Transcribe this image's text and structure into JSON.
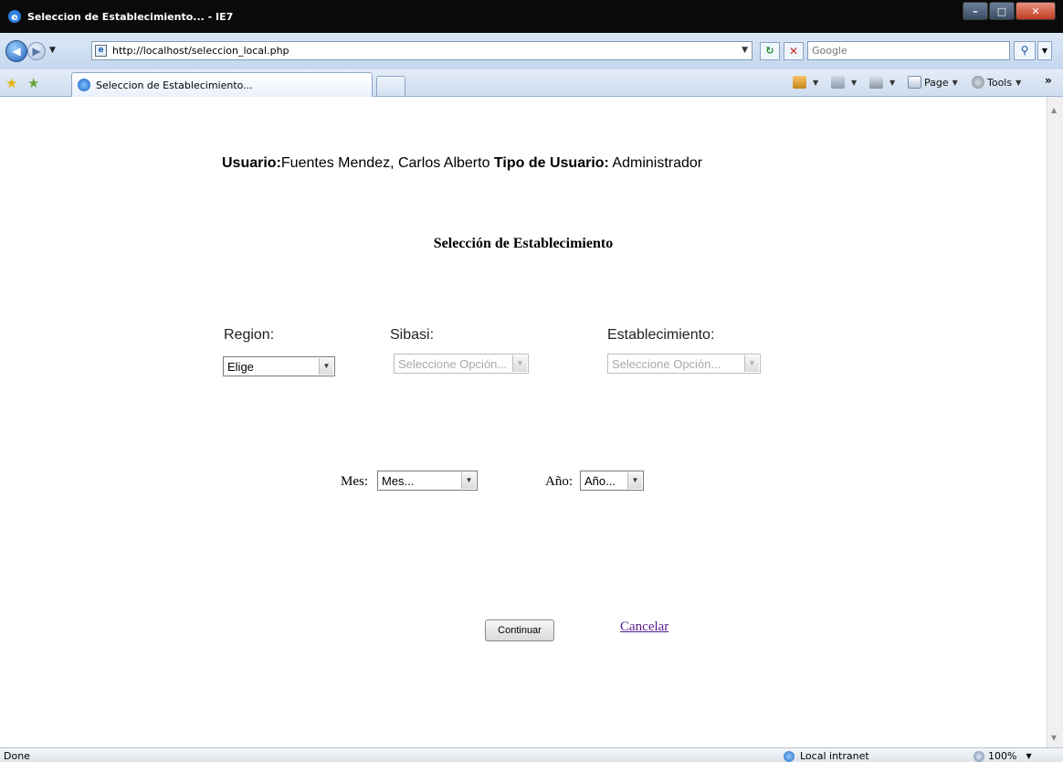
{
  "window": {
    "title": "Seleccion de Establecimiento... - IE7",
    "buttons": {
      "minimize": "–",
      "maximize": "□",
      "close": "✕"
    }
  },
  "address_bar": {
    "url": "http://localhost/seleccion_local.php",
    "search_placeholder": "Google"
  },
  "tab": {
    "label": "Seleccion de Establecimiento..."
  },
  "command_bar": {
    "page": "Page",
    "tools": "Tools"
  },
  "page": {
    "user_label": "Usuario:",
    "user_name": "Fuentes Mendez, Carlos Alberto",
    "user_type_label": "Tipo de Usuario:",
    "user_type": "Administrador",
    "heading": "Selección de Establecimiento",
    "region": {
      "label": "Region:",
      "value": "Elige"
    },
    "sibasi": {
      "label": "Sibasi:",
      "value": "Seleccione Opción..."
    },
    "establecimiento": {
      "label": "Establecimiento:",
      "value": "Seleccione Opción..."
    },
    "mes": {
      "label": "Mes:",
      "value": "Mes..."
    },
    "anio": {
      "label": "Año:",
      "value": "Año..."
    },
    "continue_button": "Continuar",
    "cancel_link": "Cancelar"
  },
  "status_bar": {
    "status": "Done",
    "zone": "Local intranet",
    "zoom": "100%"
  }
}
